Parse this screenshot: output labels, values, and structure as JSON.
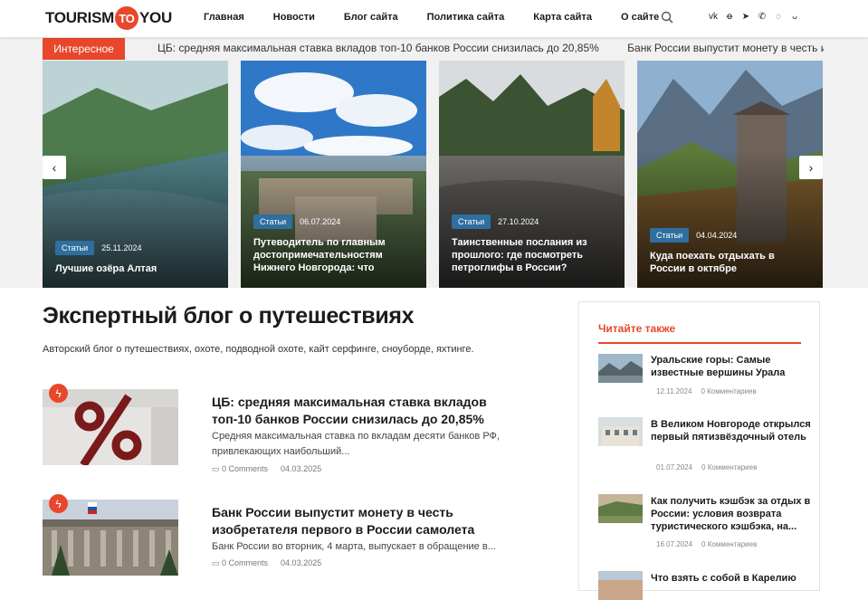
{
  "header": {
    "logo": {
      "left": "TOURISM",
      "mid": "TO",
      "right": "YOU"
    },
    "nav": [
      "Главная",
      "Новости",
      "Блог сайта",
      "Политика сайта",
      "Карта сайта",
      "О сайте"
    ],
    "search_icon": "search-icon",
    "socials": [
      {
        "name": "vk-icon",
        "glyph": "vk"
      },
      {
        "name": "odnoklassniki-icon",
        "glyph": "ꝋ"
      },
      {
        "name": "telegram-icon",
        "glyph": "➤"
      },
      {
        "name": "phone-icon",
        "glyph": "✆"
      },
      {
        "name": "whatsapp-icon",
        "glyph": "◌"
      },
      {
        "name": "max-icon",
        "glyph": "ᴗ"
      }
    ]
  },
  "ticker": {
    "label": "Интересное",
    "items": [
      "ЦБ: средняя максимальная ставка вкладов топ-10 банков России снизилась до 20,85%",
      "Банк России выпустит монету в честь изобрет"
    ]
  },
  "slider": {
    "prev": "‹",
    "next": "›",
    "cards": [
      {
        "badge": "Статьи",
        "date": "25.11.2024",
        "title": "Лучшие озёра Алтая"
      },
      {
        "badge": "Статьи",
        "date": "06.07.2024",
        "title": "Путеводитель по главным достопримечательностям Нижнего Новгорода: что"
      },
      {
        "badge": "Статьи",
        "date": "27.10.2024",
        "title": "Таинственные послания из прошлого: где посмотреть петроглифы в России?"
      },
      {
        "badge": "Статьи",
        "date": "04.04.2024",
        "title": "Куда поехать отдыхать в России в октябре"
      }
    ]
  },
  "main": {
    "title": "Экспертный блог о путешествиях",
    "subtitle": "Авторский блог о путешествиях, охоте, подводной охоте, кайт серфинге, сноуборде, яхтинге.",
    "posts": [
      {
        "title": "ЦБ: средняя максимальная ставка вкладов топ-10 банков России снизилась до 20,85%",
        "excerpt": "Средняя максимальная ставка по вкладам десяти банков РФ, привлекающих наибольший...",
        "comments": "0 Comments",
        "date": "04.03.2025"
      },
      {
        "title": "Банк России выпустит монету в честь изобретателя первого в России самолета",
        "excerpt": "Банк России во вторник, 4 марта, выпускает в обращение в...",
        "comments": "0 Comments",
        "date": "04.03.2025"
      }
    ]
  },
  "sidebar": {
    "title": "Читайте также",
    "items": [
      {
        "title": "Уральские горы: Самые известные вершины Урала",
        "date": "12.11.2024",
        "comments": "0 Комментариев"
      },
      {
        "title": "В Великом Новгороде открылся первый пятизвёздочный отель",
        "date": "01.07.2024",
        "comments": "0 Комментариев"
      },
      {
        "title": "Как получить кэшбэк за отдых в России: условия возврата туристического кэшбэка, на...",
        "date": "16.07.2024",
        "comments": "0 Комментариев"
      },
      {
        "title": "Что взять с собой в Карелию",
        "date": "",
        "comments": ""
      }
    ]
  },
  "colors": {
    "accent": "#e8472b",
    "badge": "#2f6fa0",
    "band": "#f1f1f1"
  }
}
